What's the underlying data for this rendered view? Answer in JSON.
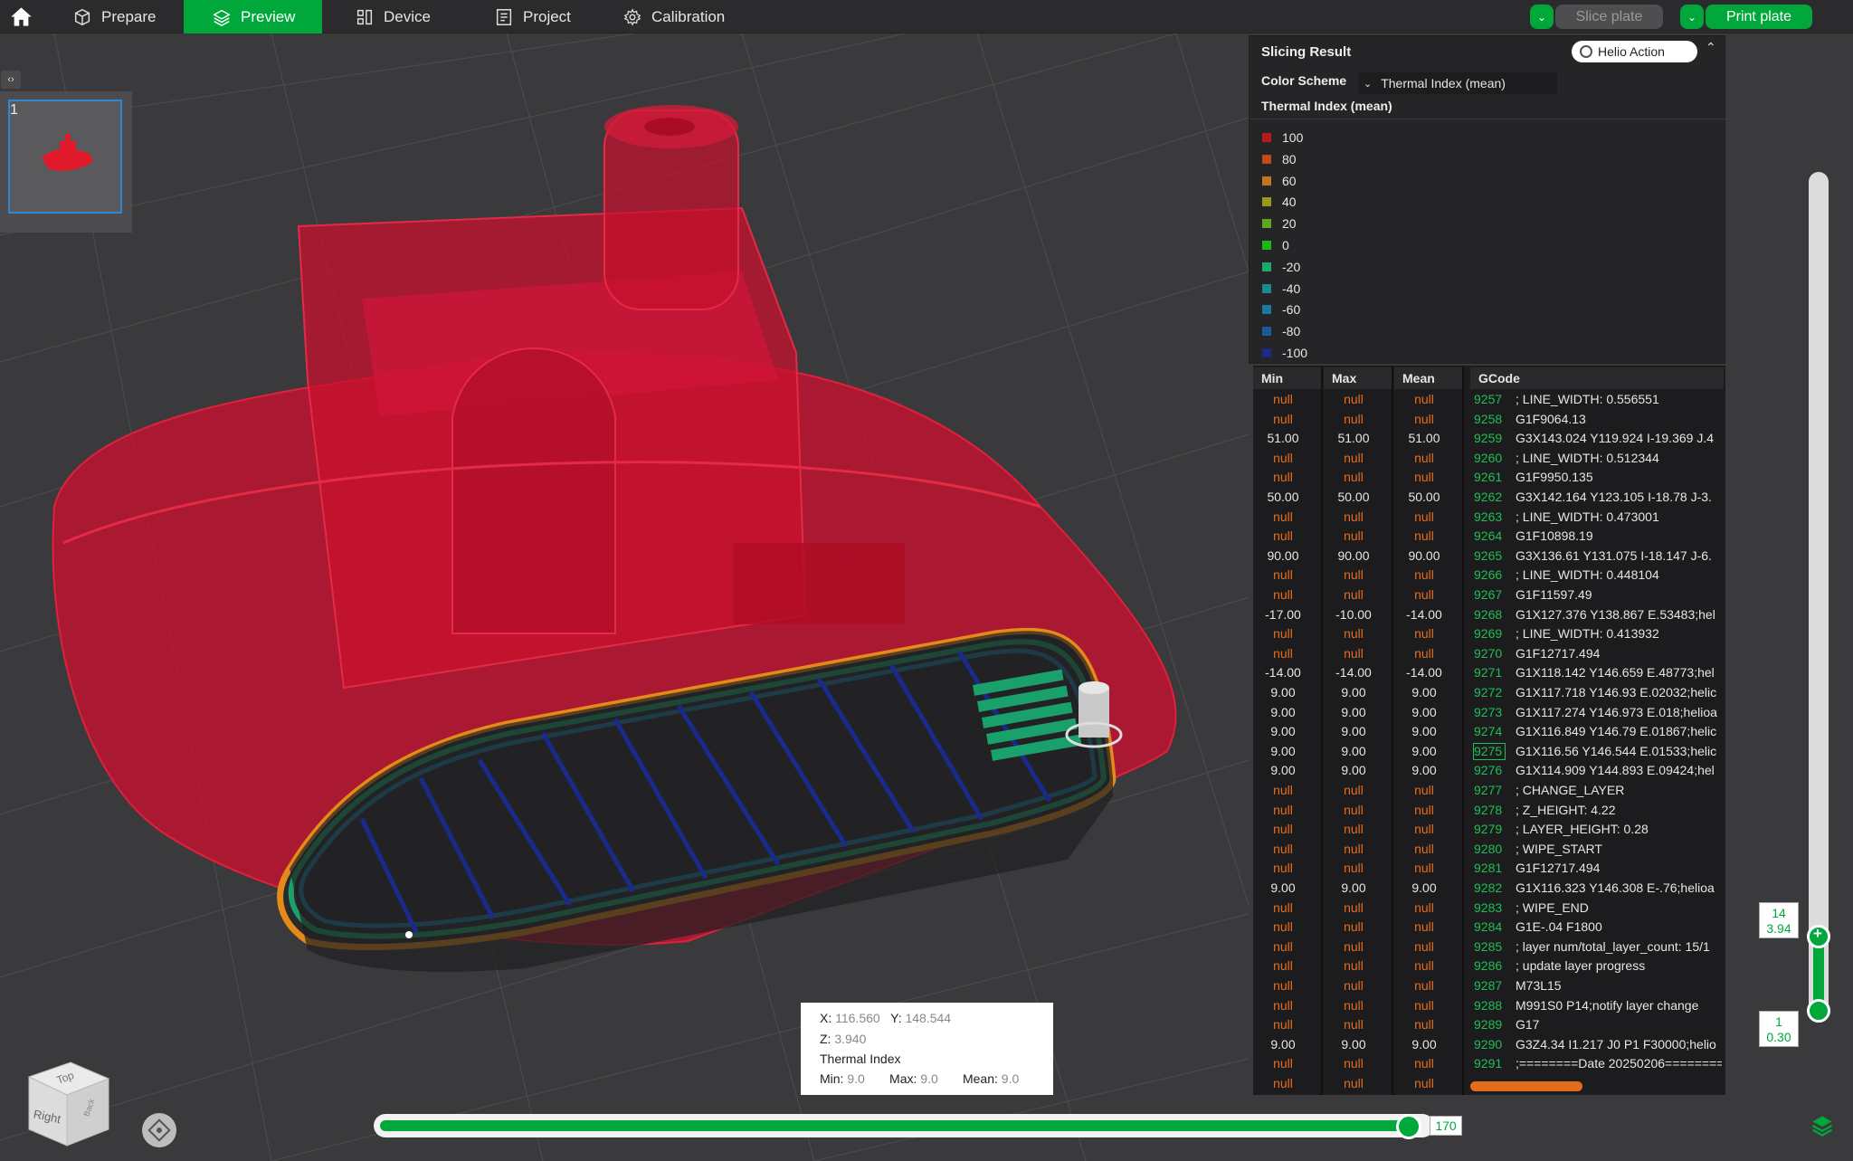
{
  "topbar": {
    "tabs": [
      {
        "label": "Prepare",
        "active": false
      },
      {
        "label": "Preview",
        "active": true
      },
      {
        "label": "Device",
        "active": false
      },
      {
        "label": "Project",
        "active": false
      },
      {
        "label": "Calibration",
        "active": false
      }
    ],
    "slice_label": "Slice plate",
    "print_label": "Print plate"
  },
  "plates": [
    {
      "number": "1"
    }
  ],
  "panel": {
    "title": "Slicing Result",
    "helio_label": "Helio Action",
    "scheme_label": "Color Scheme",
    "scheme_value": "Thermal Index (mean)",
    "legend_title": "Thermal Index (mean)",
    "legend": [
      {
        "label": "100",
        "color": "#b81a1a"
      },
      {
        "label": "80",
        "color": "#c4481a"
      },
      {
        "label": "60",
        "color": "#c4761a"
      },
      {
        "label": "40",
        "color": "#9a9a1a"
      },
      {
        "label": "20",
        "color": "#5aaa1a"
      },
      {
        "label": "0",
        "color": "#1ab81a"
      },
      {
        "label": "-20",
        "color": "#1aaa6a"
      },
      {
        "label": "-40",
        "color": "#1a8a8a"
      },
      {
        "label": "-60",
        "color": "#1a7a9a"
      },
      {
        "label": "-80",
        "color": "#1a5a9a"
      },
      {
        "label": "-100",
        "color": "#1a2a8a"
      }
    ]
  },
  "gcode_table": {
    "headers": {
      "min": "Min",
      "max": "Max",
      "mean": "Mean",
      "gcode": "GCode"
    },
    "highlight_line": "9275",
    "rows": [
      {
        "min": "null",
        "max": "null",
        "mean": "null",
        "line": "9257",
        "code": "; LINE_WIDTH: 0.556551"
      },
      {
        "min": "null",
        "max": "null",
        "mean": "null",
        "line": "9258",
        "code": "G1F9064.13"
      },
      {
        "min": "51.00",
        "max": "51.00",
        "mean": "51.00",
        "line": "9259",
        "code": "G3X143.024 Y119.924 I-19.369 J.4"
      },
      {
        "min": "null",
        "max": "null",
        "mean": "null",
        "line": "9260",
        "code": "; LINE_WIDTH: 0.512344"
      },
      {
        "min": "null",
        "max": "null",
        "mean": "null",
        "line": "9261",
        "code": "G1F9950.135"
      },
      {
        "min": "50.00",
        "max": "50.00",
        "mean": "50.00",
        "line": "9262",
        "code": "G3X142.164 Y123.105 I-18.78 J-3."
      },
      {
        "min": "null",
        "max": "null",
        "mean": "null",
        "line": "9263",
        "code": "; LINE_WIDTH: 0.473001"
      },
      {
        "min": "null",
        "max": "null",
        "mean": "null",
        "line": "9264",
        "code": "G1F10898.19"
      },
      {
        "min": "90.00",
        "max": "90.00",
        "mean": "90.00",
        "line": "9265",
        "code": "G3X136.61 Y131.075 I-18.147 J-6."
      },
      {
        "min": "null",
        "max": "null",
        "mean": "null",
        "line": "9266",
        "code": "; LINE_WIDTH: 0.448104"
      },
      {
        "min": "null",
        "max": "null",
        "mean": "null",
        "line": "9267",
        "code": "G1F11597.49"
      },
      {
        "min": "-17.00",
        "max": "-10.00",
        "mean": "-14.00",
        "line": "9268",
        "code": "G1X127.376 Y138.867 E.53483;hel"
      },
      {
        "min": "null",
        "max": "null",
        "mean": "null",
        "line": "9269",
        "code": "; LINE_WIDTH: 0.413932"
      },
      {
        "min": "null",
        "max": "null",
        "mean": "null",
        "line": "9270",
        "code": "G1F12717.494"
      },
      {
        "min": "-14.00",
        "max": "-14.00",
        "mean": "-14.00",
        "line": "9271",
        "code": "G1X118.142 Y146.659 E.48773;hel"
      },
      {
        "min": "9.00",
        "max": "9.00",
        "mean": "9.00",
        "line": "9272",
        "code": "G1X117.718 Y146.93 E.02032;helic"
      },
      {
        "min": "9.00",
        "max": "9.00",
        "mean": "9.00",
        "line": "9273",
        "code": "G1X117.274 Y146.973 E.018;helioa"
      },
      {
        "min": "9.00",
        "max": "9.00",
        "mean": "9.00",
        "line": "9274",
        "code": "G1X116.849 Y146.79 E.01867;helic"
      },
      {
        "min": "9.00",
        "max": "9.00",
        "mean": "9.00",
        "line": "9275",
        "code": "G1X116.56 Y146.544 E.01533;helic"
      },
      {
        "min": "9.00",
        "max": "9.00",
        "mean": "9.00",
        "line": "9276",
        "code": "G1X114.909 Y144.893 E.09424;hel"
      },
      {
        "min": "null",
        "max": "null",
        "mean": "null",
        "line": "9277",
        "code": "; CHANGE_LAYER"
      },
      {
        "min": "null",
        "max": "null",
        "mean": "null",
        "line": "9278",
        "code": "; Z_HEIGHT: 4.22"
      },
      {
        "min": "null",
        "max": "null",
        "mean": "null",
        "line": "9279",
        "code": "; LAYER_HEIGHT: 0.28"
      },
      {
        "min": "null",
        "max": "null",
        "mean": "null",
        "line": "9280",
        "code": "; WIPE_START"
      },
      {
        "min": "null",
        "max": "null",
        "mean": "null",
        "line": "9281",
        "code": "G1F12717.494"
      },
      {
        "min": "9.00",
        "max": "9.00",
        "mean": "9.00",
        "line": "9282",
        "code": "G1X116.323 Y146.308 E-.76;helioa"
      },
      {
        "min": "null",
        "max": "null",
        "mean": "null",
        "line": "9283",
        "code": "; WIPE_END"
      },
      {
        "min": "null",
        "max": "null",
        "mean": "null",
        "line": "9284",
        "code": "G1E-.04 F1800"
      },
      {
        "min": "null",
        "max": "null",
        "mean": "null",
        "line": "9285",
        "code": "; layer num/total_layer_count: 15/1"
      },
      {
        "min": "null",
        "max": "null",
        "mean": "null",
        "line": "9286",
        "code": "; update layer progress"
      },
      {
        "min": "null",
        "max": "null",
        "mean": "null",
        "line": "9287",
        "code": "M73L15"
      },
      {
        "min": "null",
        "max": "null",
        "mean": "null",
        "line": "9288",
        "code": "M991S0 P14;notify layer change"
      },
      {
        "min": "null",
        "max": "null",
        "mean": "null",
        "line": "9289",
        "code": "G17"
      },
      {
        "min": "9.00",
        "max": "9.00",
        "mean": "9.00",
        "line": "9290",
        "code": "G3Z4.34 I1.217 J0 P1 F30000;helio"
      },
      {
        "min": "null",
        "max": "null",
        "mean": "null",
        "line": "9291",
        "code": ";========Date 20250206========"
      },
      {
        "min": "null",
        "max": "null",
        "mean": "null",
        "line": "",
        "code": ""
      }
    ]
  },
  "layer_slider": {
    "top_layer": "14",
    "top_height": "3.94",
    "bottom_layer": "1",
    "bottom_height": "0.30"
  },
  "move_slider": {
    "value": "170"
  },
  "tooltip": {
    "x_label": "X:",
    "x_value": "116.560",
    "y_label": "Y:",
    "y_value": "148.544",
    "z_label": "Z:",
    "z_value": "3.940",
    "title": "Thermal Index",
    "min_label": "Min:",
    "min_value": "9.0",
    "max_label": "Max:",
    "max_value": "9.0",
    "mean_label": "Mean:",
    "mean_value": "9.0"
  },
  "navcube": {
    "top": "Top",
    "right": "Right",
    "back": "Back"
  }
}
